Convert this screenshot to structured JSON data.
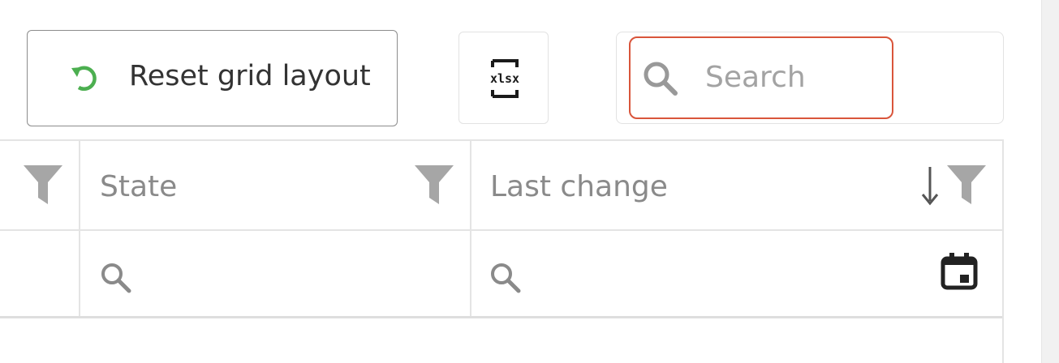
{
  "toolbar": {
    "reset_label": "Reset grid layout",
    "reset_icon": "undo-arrow-icon",
    "export_icon": "xlsx-export-icon",
    "export_icon_text": "xlsx",
    "search_placeholder": "Search",
    "search_value": "",
    "search_focus_color": "#d9553b"
  },
  "grid": {
    "columns": [
      {
        "key": "state",
        "title": "State",
        "filterable": true
      },
      {
        "key": "last_change",
        "title": "Last change",
        "filterable": true,
        "sort": "descending"
      }
    ],
    "filter_row": {
      "state_icon": "search-icon",
      "last_change_icon": "search-icon",
      "date_picker_icon": "calendar-icon"
    }
  },
  "colors": {
    "accent_green": "#4caf50",
    "icon_grey": "#a6a6a6",
    "header_text": "#8a8a8a",
    "border": "#e4e4e4"
  }
}
